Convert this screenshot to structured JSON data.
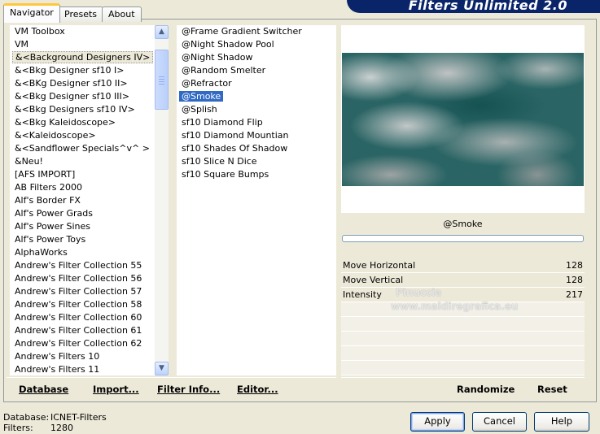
{
  "header": {
    "title": "Filters Unlimited 2.0"
  },
  "tabs": [
    {
      "label": "Navigator",
      "active": true
    },
    {
      "label": "Presets",
      "active": false
    },
    {
      "label": "About",
      "active": false
    }
  ],
  "categories": [
    {
      "label": "VM Toolbox",
      "selected": false
    },
    {
      "label": "VM",
      "selected": false
    },
    {
      "label": "&<Background Designers IV>",
      "selected": true
    },
    {
      "label": "&<Bkg Designer sf10 I>",
      "selected": false
    },
    {
      "label": "&<BKg Designer sf10 II>",
      "selected": false
    },
    {
      "label": "&<Bkg Designer sf10 III>",
      "selected": false
    },
    {
      "label": "&<Bkg Designers sf10 IV>",
      "selected": false
    },
    {
      "label": "&<Bkg Kaleidoscope>",
      "selected": false
    },
    {
      "label": "&<Kaleidoscope>",
      "selected": false
    },
    {
      "label": "&<Sandflower Specials^v^ >",
      "selected": false
    },
    {
      "label": "&Neu!",
      "selected": false
    },
    {
      "label": "[AFS IMPORT]",
      "selected": false
    },
    {
      "label": "AB Filters 2000",
      "selected": false
    },
    {
      "label": "Alf's Border FX",
      "selected": false
    },
    {
      "label": "Alf's Power Grads",
      "selected": false
    },
    {
      "label": "Alf's Power Sines",
      "selected": false
    },
    {
      "label": "Alf's Power Toys",
      "selected": false
    },
    {
      "label": "AlphaWorks",
      "selected": false
    },
    {
      "label": "Andrew's Filter Collection 55",
      "selected": false
    },
    {
      "label": "Andrew's Filter Collection 56",
      "selected": false
    },
    {
      "label": "Andrew's Filter Collection 57",
      "selected": false
    },
    {
      "label": "Andrew's Filter Collection 58",
      "selected": false
    },
    {
      "label": "Andrew's Filter Collection 60",
      "selected": false
    },
    {
      "label": "Andrew's Filter Collection 61",
      "selected": false
    },
    {
      "label": "Andrew's Filter Collection 62",
      "selected": false
    },
    {
      "label": "Andrew's Filters 10",
      "selected": false
    },
    {
      "label": "Andrew's Filters 11",
      "selected": false
    }
  ],
  "filters": [
    {
      "label": "@Frame Gradient Switcher",
      "selected": false
    },
    {
      "label": "@Night Shadow Pool",
      "selected": false
    },
    {
      "label": "@Night Shadow",
      "selected": false
    },
    {
      "label": "@Random Smelter",
      "selected": false
    },
    {
      "label": "@Refractor",
      "selected": false
    },
    {
      "label": "@Smoke",
      "selected": true
    },
    {
      "label": "@Splish",
      "selected": false
    },
    {
      "label": "sf10 Diamond Flip",
      "selected": false
    },
    {
      "label": "sf10 Diamond Mountian",
      "selected": false
    },
    {
      "label": "sf10 Shades Of Shadow",
      "selected": false
    },
    {
      "label": "sf10 Slice N Dice",
      "selected": false
    },
    {
      "label": "sf10 Square Bumps",
      "selected": false
    }
  ],
  "preview": {
    "filter_name": "@Smoke"
  },
  "params": [
    {
      "label": "Move Horizontal",
      "value": "128"
    },
    {
      "label": "Move Vertical",
      "value": "128"
    },
    {
      "label": "Intensity",
      "value": "217"
    }
  ],
  "watermark": {
    "line1": "Pinuccia",
    "line2": "www.maldiregrafica.eu"
  },
  "links": {
    "database": "Database",
    "import": "Import...",
    "filter_info": "Filter Info...",
    "editor": "Editor...",
    "randomize": "Randomize",
    "reset": "Reset"
  },
  "status": {
    "database_label": "Database:",
    "database_value": "ICNET-Filters",
    "filters_label": "Filters:",
    "filters_value": "1280"
  },
  "buttons": {
    "apply": "Apply",
    "cancel": "Cancel",
    "help": "Help"
  },
  "colors": {
    "selection": "#316ac5",
    "banner": "#0a246a",
    "preview_base": "#2a6464"
  }
}
